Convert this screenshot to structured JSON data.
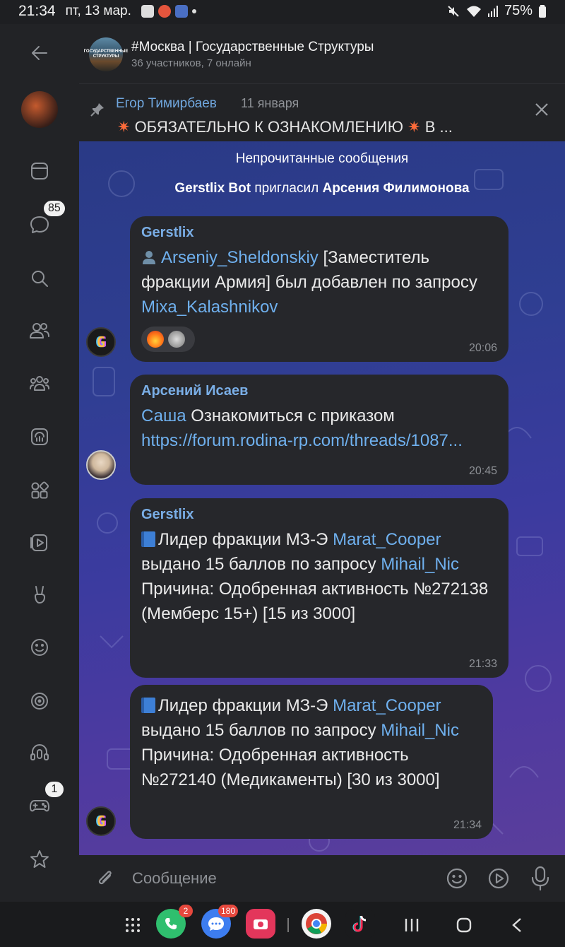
{
  "status_bar": {
    "time": "21:34",
    "date": "пт, 13 мар.",
    "battery": "75%"
  },
  "rail": {
    "chats_badge": "85",
    "games_badge": "1"
  },
  "header": {
    "title": "#Москва | Государственные Структуры",
    "subtitle": "36 участников, 7 онлайн",
    "avatar_text": "ГОСУДАРСТВЕННЫЕ СТРУКТУРЫ"
  },
  "pinned": {
    "author": "Егор Тимирбаев",
    "date": "11 января",
    "text": "ОБЯЗАТЕЛЬНО К ОЗНАКОМЛЕНИЮ",
    "text_tail": "В ..."
  },
  "system": {
    "unread_label": "Непрочитанные сообщения",
    "invite_actor": "Gerstlix Bot",
    "invite_verb": " пригласил ",
    "invite_target": "Арсения Филимонова"
  },
  "messages": [
    {
      "author": "Gerstlix",
      "mention1": "Arseniy_Sheldonskiy",
      "text1": " [Заместитель фракции Армия] был добавлен по запросу ",
      "mention2": "Mixa_Kalashnikov",
      "time": "20:06"
    },
    {
      "author": "Арсений Исаев",
      "mention1": "Саша",
      "text1": "  Ознакомиться с приказом",
      "link": "https://forum.rodina-rp.com/threads/1087...",
      "time": "20:45"
    },
    {
      "author": "Gerstlix",
      "text1": "Лидер фракции МЗ-Э ",
      "mention1": "Marat_Cooper",
      "text2": " выдано 15 баллов по запросу ",
      "mention2": "Mihail_Nic",
      "text3": "Причина: Одобренная активность №272138 (Мемберс 15+) [15 из 3000]",
      "time": "21:33"
    },
    {
      "text1": "Лидер фракции МЗ-Э ",
      "mention1": "Marat_Cooper",
      "text2": " выдано 15 баллов по запросу ",
      "mention2": "Mihail_Nic",
      "text3": "Причина: Одобренная активность №272140 (Медикаменты) [30 из 3000]",
      "time": "21:34"
    }
  ],
  "composer": {
    "placeholder": "Сообщение"
  },
  "navbar": {
    "phone_badge": "2",
    "messages_badge": "180"
  }
}
